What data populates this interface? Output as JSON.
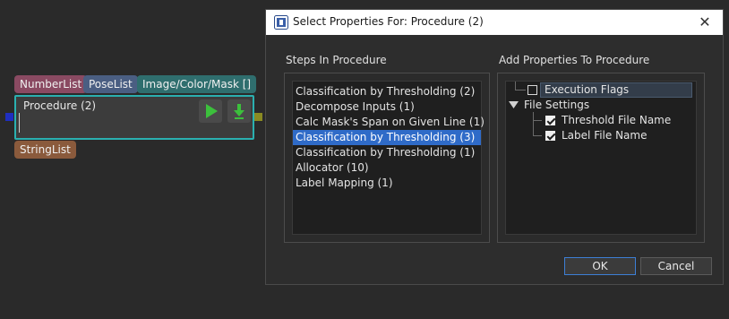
{
  "node_editor": {
    "tags": {
      "number_list": "NumberList",
      "pose_list": "PoseList",
      "image_mask": "Image/Color/Mask []",
      "string_list": "StringList"
    },
    "node": {
      "title": "Procedure (2)",
      "run_icon": "play-icon",
      "download_icon": "download-icon"
    }
  },
  "dialog": {
    "title": "Select Properties For: Procedure (2)",
    "close_symbol": "✕",
    "steps_label": "Steps In Procedure",
    "props_label": "Add Properties To Procedure",
    "steps": [
      "Classification by Thresholding (2)",
      "Decompose Inputs (1)",
      "Calc Mask's Span on Given Line (1)",
      "Classification by Thresholding (3)",
      "Classification by Thresholding (1)",
      "Allocator (10)",
      "Label Mapping (1)"
    ],
    "selected_step_index": 3,
    "properties": {
      "execution_flags": "Execution Flags",
      "file_settings": "File Settings",
      "threshold_file_name": "Threshold File Name",
      "label_file_name": "Label File Name"
    },
    "checked": {
      "execution_flags": false,
      "threshold_file_name": true,
      "label_file_name": true
    },
    "ok_label": "OK",
    "cancel_label": "Cancel"
  },
  "colors": {
    "selection": "#2f6bc8",
    "node_border": "#2ab0b0",
    "ok_border": "#3d7fd6"
  }
}
